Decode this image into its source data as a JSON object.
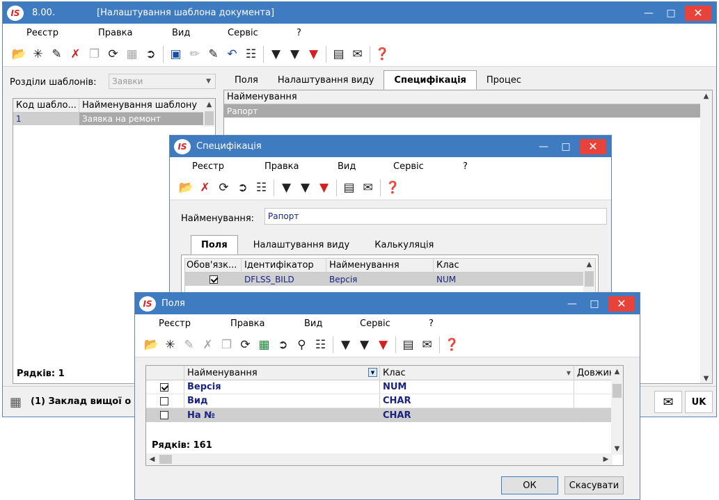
{
  "main": {
    "title_version": "8.00.",
    "title": "[Налаштування шаблона документа]",
    "menu": [
      "Реєстр",
      "Правка",
      "Вид",
      "Сервіс",
      "?"
    ],
    "sections_label": "Розділи шаблонів:",
    "sections_value": "Заявки",
    "left_columns": [
      "Код шабло...",
      "Найменування шаблону"
    ],
    "left_rows": [
      {
        "code": "1",
        "name": "Заявка на ремонт"
      }
    ],
    "rows_count": "Рядків: 1",
    "status_org": "(1) Заклад вищої о",
    "status_lang": "UK",
    "tabs": [
      "Поля",
      "Налаштування виду",
      "Специфікація",
      "Процес"
    ],
    "active_tab": "Специфікація",
    "right_column": "Найменування",
    "right_rows": [
      "Рапорт"
    ]
  },
  "spec": {
    "title": "Специфікація",
    "menu": [
      "Реєстр",
      "Правка",
      "Вид",
      "Сервіс",
      "?"
    ],
    "name_label": "Найменування:",
    "name_value": "Рапорт",
    "tabs": [
      "Поля",
      "Налаштування виду",
      "Калькуляція"
    ],
    "active_tab": "Поля",
    "columns": [
      "Обов'язк...",
      "Ідентифікатор",
      "Найменування",
      "Клас"
    ],
    "rows": [
      {
        "required": true,
        "id": "DFLSS_BILD",
        "name": "Версія",
        "class": "NUM"
      }
    ]
  },
  "fields": {
    "title": "Поля",
    "menu": [
      "Реєстр",
      "Правка",
      "Вид",
      "Сервіс",
      "?"
    ],
    "columns": [
      "Найменування",
      "Клас",
      "Довжин"
    ],
    "rows": [
      {
        "checked": true,
        "name": "Версія",
        "class": "NUM"
      },
      {
        "checked": false,
        "name": "Вид",
        "class": "CHAR"
      },
      {
        "checked": false,
        "name": "На №",
        "class": "CHAR"
      }
    ],
    "rows_count": "Рядків: 161",
    "ok_label": "ОК",
    "cancel_label": "Скасувати"
  }
}
